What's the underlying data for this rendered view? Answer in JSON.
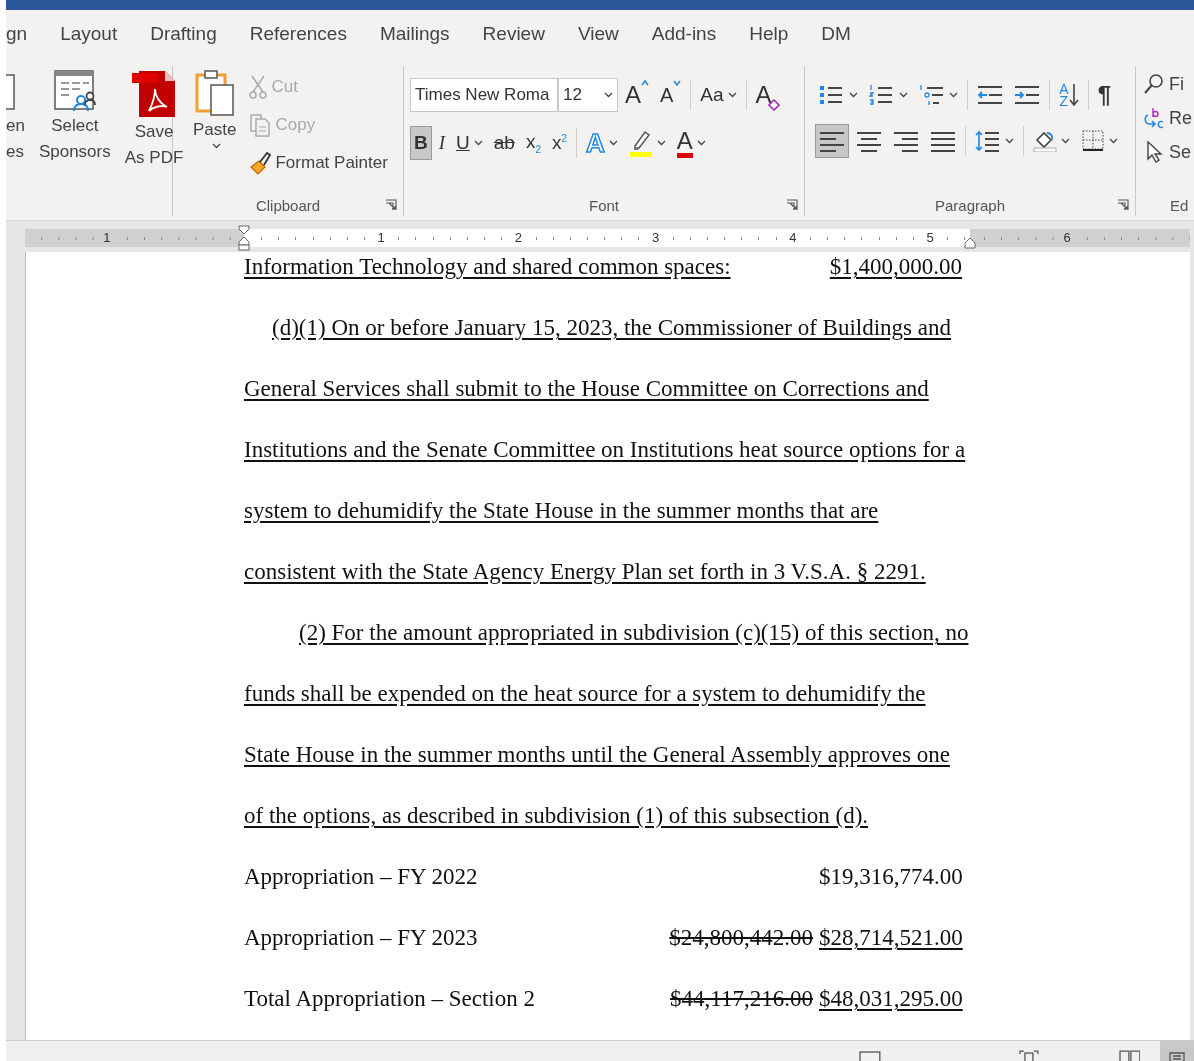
{
  "tabs": [
    {
      "label": "gn",
      "selected": false
    },
    {
      "label": "Layout",
      "selected": false
    },
    {
      "label": "Drafting",
      "selected": false
    },
    {
      "label": "References",
      "selected": false
    },
    {
      "label": "Mailings",
      "selected": false
    },
    {
      "label": "Review",
      "selected": false
    },
    {
      "label": "View",
      "selected": false
    },
    {
      "label": "Add-ins",
      "selected": false
    },
    {
      "label": "Help",
      "selected": false
    },
    {
      "label": "DM",
      "selected": false
    }
  ],
  "ribbon": {
    "left_buttons": [
      {
        "kind": "document",
        "lines": [
          "en",
          "es"
        ]
      },
      {
        "kind": "sponsors",
        "lines": [
          "Select",
          "Sponsors"
        ]
      },
      {
        "kind": "pdf",
        "lines": [
          "Save",
          "As PDF"
        ]
      }
    ],
    "clipboard": {
      "title": "Clipboard",
      "paste": "Paste",
      "items": [
        {
          "kind": "cut",
          "label": "Cut",
          "disabled": true
        },
        {
          "kind": "copy",
          "label": "Copy",
          "disabled": true
        },
        {
          "kind": "painter",
          "label": "Format Painter",
          "disabled": false
        }
      ]
    },
    "font": {
      "title": "Font",
      "name": "Times New Roma",
      "size": "12",
      "row1": [
        {
          "kind": "grow",
          "glyph": "A",
          "selected": false
        },
        {
          "kind": "shrink",
          "glyph": "A",
          "selected": false
        },
        {
          "kind": "case",
          "glyph": "Aa",
          "dropdown": true,
          "selected": false
        },
        {
          "kind": "clear",
          "glyph": "A",
          "selected": false
        }
      ],
      "row2": [
        {
          "kind": "bold",
          "glyph": "B",
          "selected": true
        },
        {
          "kind": "italic",
          "glyph": "I",
          "selected": false
        },
        {
          "kind": "underline",
          "glyph": "U",
          "dropdown": true,
          "selected": false
        },
        {
          "kind": "strike",
          "glyph": "ab",
          "selected": false
        },
        {
          "kind": "subscript",
          "glyph": "x$_{2}$",
          "selected": false
        },
        {
          "kind": "superscript",
          "glyph": "x$^{2}$",
          "selected": false
        },
        {
          "kind": "effects",
          "glyph": "A",
          "dropdown": true,
          "selected": false
        },
        {
          "kind": "highlight",
          "dropdown": true,
          "selected": false
        },
        {
          "kind": "color",
          "glyph": "A",
          "dropdown": true,
          "selected": false
        }
      ]
    },
    "paragraph": {
      "title": "Paragraph",
      "row1": [
        {
          "kind": "bullets",
          "dropdown": true,
          "selected": false
        },
        {
          "kind": "numbering",
          "dropdown": true,
          "selected": false
        },
        {
          "kind": "multilevel",
          "dropdown": true,
          "selected": false
        },
        {
          "kind": "outdent",
          "selected": false
        },
        {
          "kind": "indent",
          "selected": false
        },
        {
          "kind": "sort",
          "glyph": "AZ",
          "selected": false
        },
        {
          "kind": "marks",
          "glyph": "¶",
          "selected": false
        }
      ],
      "row2": [
        {
          "kind": "left",
          "selected": true
        },
        {
          "kind": "center",
          "selected": false
        },
        {
          "kind": "right",
          "selected": false
        },
        {
          "kind": "justify",
          "selected": false
        },
        {
          "kind": "spacing",
          "dropdown": true,
          "selected": false
        },
        {
          "kind": "shading",
          "dropdown": true,
          "selected": false
        },
        {
          "kind": "borders",
          "dropdown": true,
          "selected": false
        }
      ]
    },
    "editing": {
      "title": "Ed",
      "items": [
        {
          "kind": "find",
          "label": "Fi"
        },
        {
          "kind": "replace",
          "label": "Re"
        },
        {
          "kind": "select",
          "label": "Se"
        }
      ]
    }
  },
  "ruler": {
    "numbers": [
      "1",
      "1",
      "2",
      "3",
      "4",
      "5",
      "6"
    ]
  },
  "document": [
    {
      "kind": "amount",
      "label": "Information Technology and shared common spaces:",
      "label_underlined": true,
      "amount": "$1,400,000.00",
      "amount_underlined": true
    },
    {
      "kind": "indented_line",
      "text": "(d)(1)  On or before January 15, 2023, the Commissioner of Buildings and",
      "underlined": true
    },
    {
      "kind": "line",
      "text": "General Services shall submit to the House Committee on Corrections and",
      "underlined": true
    },
    {
      "kind": "line",
      "text": "Institutions and the Senate Committee on Institutions heat source options for a",
      "underlined": true
    },
    {
      "kind": "line",
      "text": "system to dehumidify the State House in the summer months that are",
      "underlined": true
    },
    {
      "kind": "line",
      "text": "consistent with the State Agency Energy Plan set forth in 3 V.S.A. § 2291.",
      "underlined": true
    },
    {
      "kind": "deep_indented_line",
      "text": "(2)  For the amount appropriated in subdivision (c)(15) of this section, no",
      "underlined": true
    },
    {
      "kind": "line",
      "text": "funds shall be expended on the heat source for a system to dehumidify the",
      "underlined": true
    },
    {
      "kind": "line",
      "text": "State House in the summer months until the General Assembly approves one",
      "underlined": true
    },
    {
      "kind": "line",
      "text": "of the options, as described in subdivision (1) of this subsection (d).",
      "underlined": true
    },
    {
      "kind": "amount",
      "label": "Appropriation – FY 2022",
      "label_underlined": false,
      "amount": "$19,316,774.00",
      "amount_underlined": false
    },
    {
      "kind": "amount",
      "label": "Appropriation – FY 2023",
      "label_underlined": false,
      "struck_amount": "$24,800,442.00",
      "amount": "$28,714,521.00",
      "amount_underlined": true
    },
    {
      "kind": "amount",
      "label": "Total Appropriation – Section 2",
      "label_underlined": false,
      "struck_amount": "$44,117,216.00",
      "amount": "$48,031,295.00",
      "amount_underlined": true
    }
  ]
}
